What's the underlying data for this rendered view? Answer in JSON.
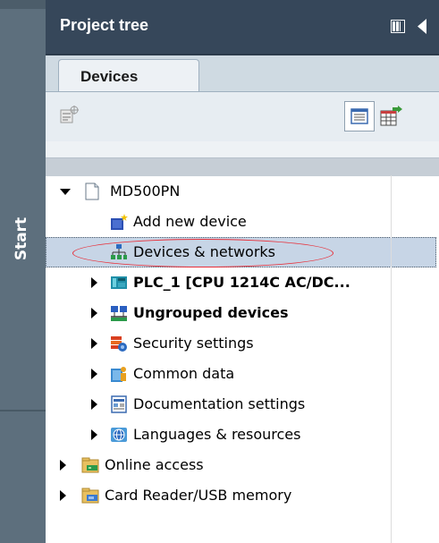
{
  "sidebar": {
    "start_label": "Start"
  },
  "header": {
    "title": "Project tree"
  },
  "tabs": [
    {
      "label": "Devices"
    }
  ],
  "tree": {
    "project": "MD500PN",
    "items": [
      {
        "label": "Add new device"
      },
      {
        "label": "Devices & networks"
      },
      {
        "label": "PLC_1 [CPU 1214C AC/DC..."
      },
      {
        "label": "Ungrouped devices"
      },
      {
        "label": "Security settings"
      },
      {
        "label": "Common data"
      },
      {
        "label": "Documentation settings"
      },
      {
        "label": "Languages & resources"
      },
      {
        "label": "Online access"
      },
      {
        "label": "Card Reader/USB memory"
      }
    ]
  },
  "colors": {
    "header": "#36475a",
    "sidebar": "#5d6f7d",
    "selection": "#c7d5e6",
    "annotation": "#e8303a"
  }
}
